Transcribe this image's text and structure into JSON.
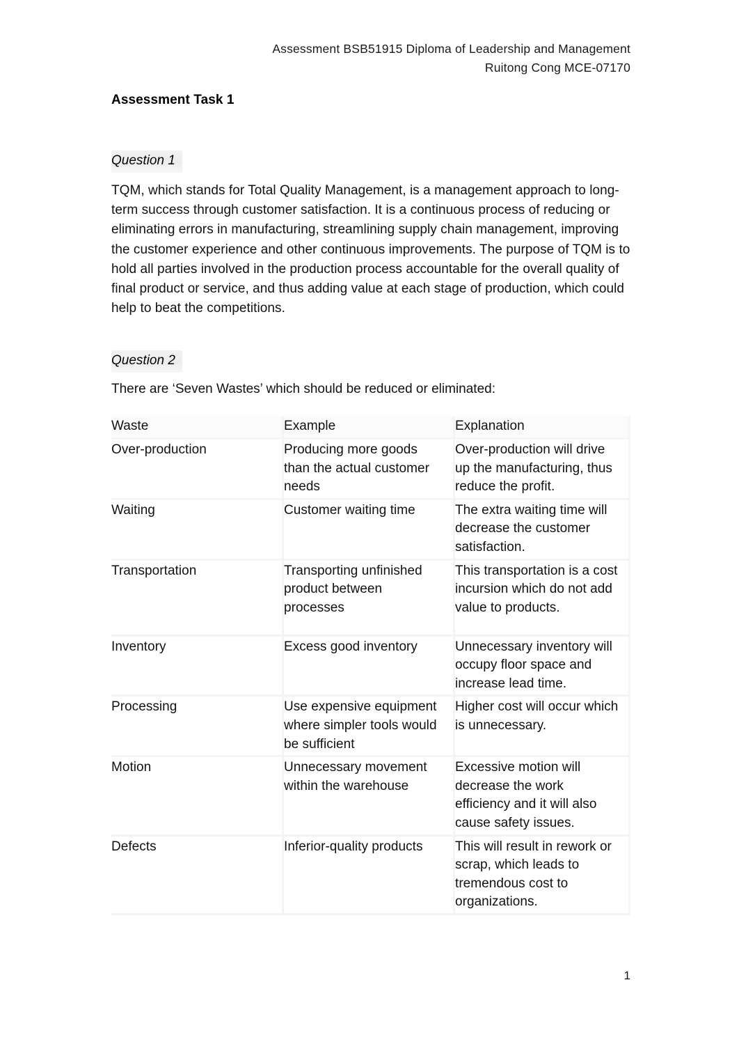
{
  "document": {
    "header_line_1": "Assessment BSB51915 Diploma of Leadership and Management",
    "header_line_2": "Ruitong Cong MCE-07170",
    "task_title": "Assessment Task 1",
    "page_number": "1"
  },
  "question1": {
    "label": "Question 1",
    "answer": "TQM, which stands for Total Quality Management, is a management approach to long-term success through customer satisfaction. It is a continuous process of reducing or eliminating errors in manufacturing, streamlining supply chain management, improving the customer experience and other continuous improvements. The purpose of TQM is to hold all parties involved in the production process accountable for the overall quality of final product or service, and thus adding value at each stage of production, which could help to beat the competitions."
  },
  "question2": {
    "label": "Question 2",
    "intro": "There are ‘Seven Wastes’ which should be reduced or eliminated:",
    "table": {
      "headers": [
        "Waste",
        "Example",
        "Explanation"
      ],
      "rows": [
        {
          "waste": "Over-production",
          "example": "Producing more goods than the actual customer needs",
          "explanation": "Over-production will drive up the manufacturing, thus reduce the profit."
        },
        {
          "waste": "Waiting",
          "example": "Customer waiting time",
          "explanation": "The extra waiting time will decrease the customer satisfaction."
        },
        {
          "waste": "Transportation",
          "example": "Transporting unfinished product between processes",
          "explanation": "This transportation is a cost incursion which do not add value to products."
        },
        {
          "waste": "Inventory",
          "example": "Excess good inventory",
          "explanation": "Unnecessary inventory will occupy floor space and increase lead time."
        },
        {
          "waste": "Processing",
          "example": "Use expensive equipment where simpler tools would be sufficient",
          "explanation": "Higher cost will occur which is unnecessary."
        },
        {
          "waste": "Motion",
          "example": "Unnecessary movement within the warehouse",
          "explanation": "Excessive motion will decrease the work efficiency and it will also cause safety issues."
        },
        {
          "waste": "Defects",
          "example": "Inferior-quality products",
          "explanation": "This will result in rework or scrap, which leads to tremendous cost to organizations."
        }
      ]
    }
  },
  "colors": {
    "text": "#111111",
    "table_border": "#f4f4f4",
    "highlight": "#f0f0f0"
  }
}
